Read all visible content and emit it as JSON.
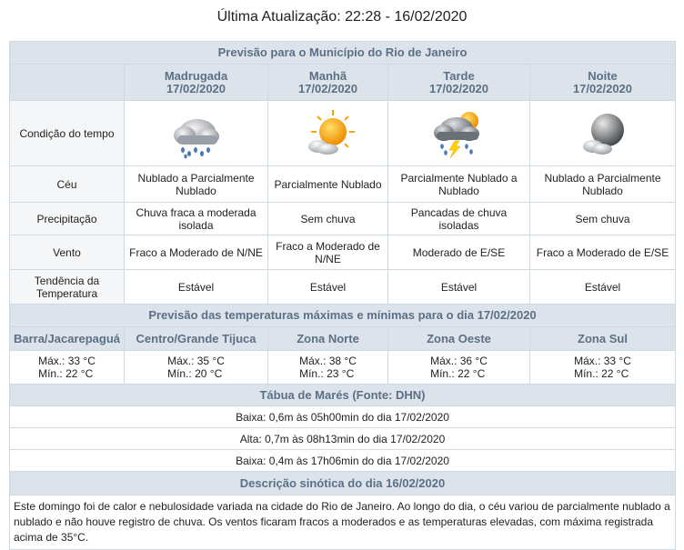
{
  "update_text": "Última Atualização: 22:28 - 16/02/2020",
  "forecast_title": "Previsão para o Município do Rio de Janeiro",
  "periods": [
    {
      "name": "Madrugada",
      "date": "17/02/2020",
      "icon": "rain-cloud-icon",
      "ceu": "Nublado a Parcialmente Nublado",
      "precip": "Chuva fraca a moderada isolada",
      "vento": "Fraco a Moderado de N/NE",
      "tendencia": "Estável"
    },
    {
      "name": "Manhã",
      "date": "17/02/2020",
      "icon": "sun-cloud-icon",
      "ceu": "Parcialmente Nublado",
      "precip": "Sem chuva",
      "vento": "Fraco a Moderado de N/NE",
      "tendencia": "Estável"
    },
    {
      "name": "Tarde",
      "date": "17/02/2020",
      "icon": "thunderstorm-icon",
      "ceu": "Parcialmente Nublado a Nublado",
      "precip": "Pancadas de chuva isoladas",
      "vento": "Moderado de E/SE",
      "tendencia": "Estável"
    },
    {
      "name": "Noite",
      "date": "17/02/2020",
      "icon": "moon-cloud-icon",
      "ceu": "Nublado a Parcialmente Nublado",
      "precip": "Sem chuva",
      "vento": "Fraco a Moderado de E/SE",
      "tendencia": "Estável"
    }
  ],
  "row_labels": {
    "condicao": "Condição do tempo",
    "ceu": "Céu",
    "precip": "Precipitação",
    "vento": "Vento",
    "tendencia": "Tendência da Temperatura"
  },
  "temps_title": "Previsão das temperaturas máximas e mínimas para o dia 17/02/2020",
  "zones": [
    {
      "name": "Barra/Jacarepaguá",
      "max": "Máx.: 33 °C",
      "min": "Mín.: 22 °C"
    },
    {
      "name": "Centro/Grande Tijuca",
      "max": "Máx.: 35 °C",
      "min": "Mín.: 20 °C"
    },
    {
      "name": "Zona Norte",
      "max": "Máx.: 38 °C",
      "min": "Mín.: 23 °C"
    },
    {
      "name": "Zona Oeste",
      "max": "Máx.: 36 °C",
      "min": "Mín.: 22 °C"
    },
    {
      "name": "Zona Sul",
      "max": "Máx.: 33 °C",
      "min": "Mín.: 22 °C"
    }
  ],
  "tides_title": "Tábua de Marés (Fonte: DHN)",
  "tides": [
    "Baixa: 0,6m às 05h00min do dia 17/02/2020",
    "Alta: 0,7m às 08h13min do dia 17/02/2020",
    "Baixa: 0,4m às 17h06min do dia 17/02/2020"
  ],
  "synoptic_title": "Descrição sinótica do dia 16/02/2020",
  "synoptic_text": "Este domingo foi de calor e nebulosidade variada na cidade do Rio de Janeiro. Ao longo do dia, o céu variou de parcialmente nublado a nublado e não houve registro de chuva. Os ventos ficaram fracos a moderados e as temperaturas elevadas, com máxima registrada acima de 35°C.",
  "colors": {
    "header_bg": "#dde3ea",
    "header_text": "#5b7086",
    "border": "#d0d8e0"
  }
}
